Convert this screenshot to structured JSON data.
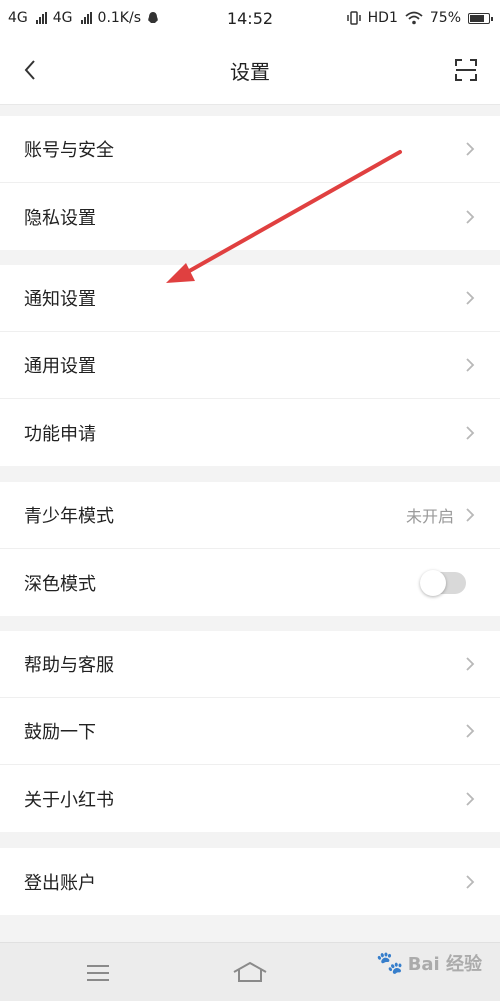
{
  "status_bar": {
    "network1": "4G",
    "network2": "4G",
    "speed": "0.1K/s",
    "time": "14:52",
    "hd": "HD1",
    "battery": "75%"
  },
  "header": {
    "title": "设置",
    "back_icon": "chevron-left-icon",
    "scan_icon": "scan-icon"
  },
  "groups": [
    {
      "items": [
        {
          "label": "账号与安全"
        },
        {
          "label": "隐私设置"
        }
      ]
    },
    {
      "items": [
        {
          "label": "通知设置"
        },
        {
          "label": "通用设置"
        },
        {
          "label": "功能申请"
        }
      ]
    },
    {
      "items": [
        {
          "label": "青少年模式",
          "value": "未开启"
        },
        {
          "label": "深色模式",
          "toggle": false
        }
      ]
    },
    {
      "items": [
        {
          "label": "帮助与客服"
        },
        {
          "label": "鼓励一下"
        },
        {
          "label": "关于小红书"
        }
      ]
    },
    {
      "items": [
        {
          "label": "登出账户"
        }
      ]
    }
  ],
  "annotation": {
    "color": "#e04040"
  },
  "bottom_nav": {
    "menu_icon": "menu-icon",
    "home_icon": "home-icon"
  },
  "watermark": {
    "text": "Bai 经验"
  }
}
